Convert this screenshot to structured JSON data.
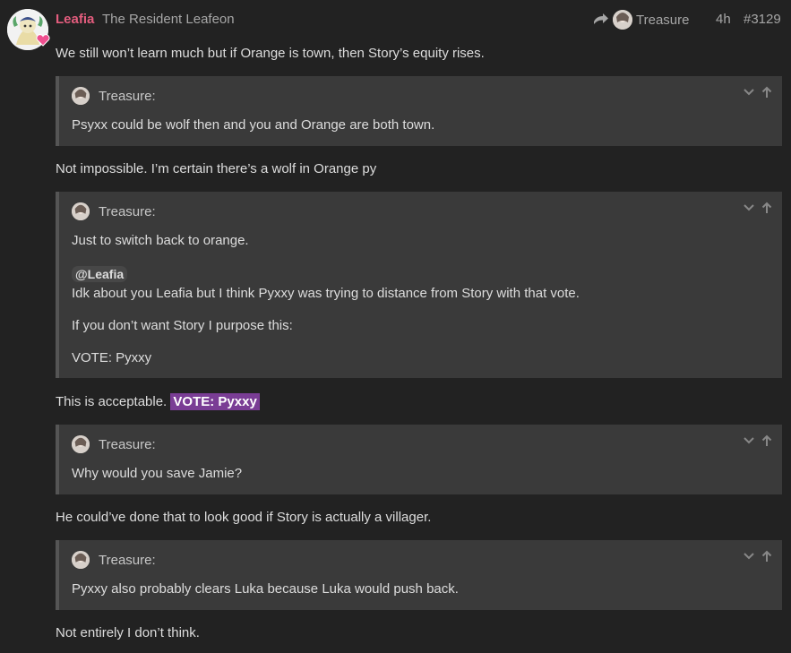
{
  "post": {
    "author": "Leafia",
    "author_title": "The Resident Leafeon",
    "reply_to": "Treasure",
    "time": "4h",
    "post_number": "#3129"
  },
  "content": {
    "p1": "We still won’t learn much but if Orange is town, then Story’s equity rises.",
    "q1": {
      "author": "Treasure:",
      "text": "Psyxx could be wolf then and you and Orange are both town."
    },
    "p2": "Not impossible. I’m certain there’s a wolf in Orange py",
    "q2": {
      "author": "Treasure:",
      "line1": "Just to switch back to orange.",
      "mention": "@Leafia",
      "line2": "Idk about you Leafia but I think Pyxxy was trying to distance from Story with that vote.",
      "line3": "If you don’t want Story I purpose this:",
      "line4": "VOTE: Pyxxy"
    },
    "p3_prefix": "This is acceptable.",
    "p3_vote": "VOTE: Pyxxy",
    "q3": {
      "author": "Treasure:",
      "text": "Why would you save Jamie?"
    },
    "p4": "He could’ve done that to look good if Story is actually a villager.",
    "q4": {
      "author": "Treasure:",
      "text": "Pyxxy also probably clears Luka because Luka would push back."
    },
    "p5": "Not entirely I don’t think."
  },
  "colors": {
    "background": "#222222",
    "username": "#e45d7e",
    "quote_bg": "#3a3a3a",
    "vote_highlight": "#7a3d95"
  },
  "icons": [
    "reply-arrow-icon",
    "chevron-down-icon",
    "arrow-up-icon",
    "heart-icon"
  ]
}
